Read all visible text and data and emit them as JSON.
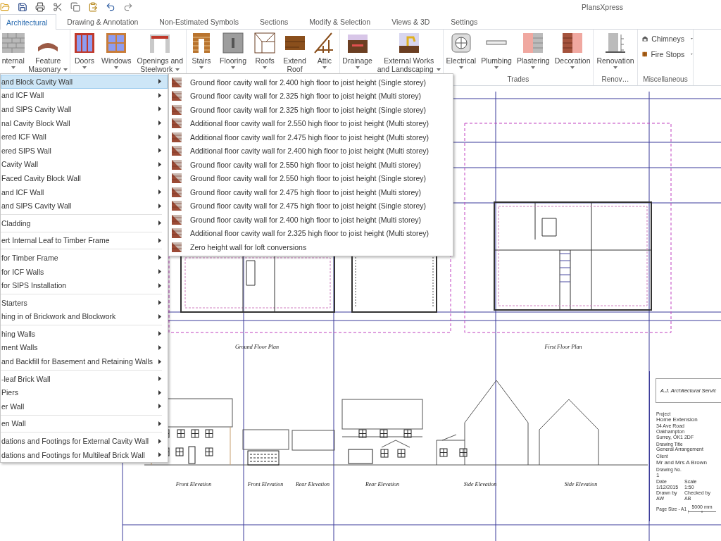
{
  "app": {
    "title": "PlansXpress"
  },
  "tabs": [
    {
      "label": "Architectural",
      "selected": true
    },
    {
      "label": "Drawing & Annotation",
      "selected": false
    },
    {
      "label": "Non-Estimated Symbols",
      "selected": false
    },
    {
      "label": "Sections",
      "selected": false
    },
    {
      "label": "Modify & Selection",
      "selected": false
    },
    {
      "label": "Views & 3D",
      "selected": false
    },
    {
      "label": "Settings",
      "selected": false
    }
  ],
  "ribbon": {
    "groups": [
      {
        "kind": "large",
        "buttons": [
          {
            "label": "nternal",
            "dropdown": true
          },
          {
            "label": "Feature Masonary",
            "dropdown": true
          }
        ]
      },
      {
        "kind": "large",
        "buttons": [
          {
            "label": "Doors",
            "dropdown": true
          },
          {
            "label": "Windows",
            "dropdown": true
          },
          {
            "label": "Openings and Steelwork",
            "dropdown": true
          }
        ]
      },
      {
        "kind": "large",
        "buttons": [
          {
            "label": "Stairs",
            "dropdown": true
          },
          {
            "label": "Flooring",
            "dropdown": true
          },
          {
            "label": "Roofs",
            "dropdown": true
          },
          {
            "label": "Extend Roof",
            "dropdown": false
          },
          {
            "label": "Attic",
            "dropdown": true
          }
        ]
      },
      {
        "kind": "large",
        "buttons": [
          {
            "label": "Drainage",
            "dropdown": true
          },
          {
            "label": "External Works and Landscaping",
            "dropdown": true
          }
        ]
      },
      {
        "kind": "large",
        "label": "Trades",
        "buttons": [
          {
            "label": "Electrical",
            "dropdown": true
          },
          {
            "label": "Plumbing",
            "dropdown": true
          },
          {
            "label": "Plastering",
            "dropdown": true
          },
          {
            "label": "Decoration",
            "dropdown": true
          }
        ]
      },
      {
        "kind": "large",
        "label": "Renov…",
        "buttons": [
          {
            "label": "Renovation",
            "dropdown": true
          }
        ]
      },
      {
        "kind": "small",
        "label": "Miscellaneous",
        "buttons": [
          {
            "label": "Chimneys",
            "dropdown": true
          },
          {
            "label": "Fire Stops",
            "dropdown": true
          }
        ]
      }
    ]
  },
  "menu": {
    "groups": [
      {
        "items": [
          {
            "label": "and Block Cavity Wall",
            "selected": true
          },
          {
            "label": "and ICF Wall",
            "selected": false
          },
          {
            "label": "and SIPS Cavity Wall",
            "selected": false
          },
          {
            "label": "nal Cavity Block Wall",
            "selected": false
          },
          {
            "label": "ered ICF Wall",
            "selected": false
          },
          {
            "label": "ered SIPS Wall",
            "selected": false
          },
          {
            "label": "Cavity Wall",
            "selected": false
          },
          {
            "label": "Faced Cavity Block Wall",
            "selected": false
          },
          {
            "label": "and ICF Wall",
            "selected": false
          },
          {
            "label": "and SIPS Cavity Wall",
            "selected": false
          }
        ]
      },
      {
        "items": [
          {
            "label": "Cladding",
            "selected": false
          }
        ]
      },
      {
        "items": [
          {
            "label": "ert Internal Leaf to Timber Frame",
            "selected": false
          }
        ]
      },
      {
        "items": [
          {
            "label": "for Timber Frame",
            "selected": false
          },
          {
            "label": "for ICF Walls",
            "selected": false
          },
          {
            "label": "for SIPS Installation",
            "selected": false
          }
        ]
      },
      {
        "items": [
          {
            "label": "Starters",
            "selected": false
          },
          {
            "label": "hing in of Brickwork and Blockwork",
            "selected": false
          }
        ]
      },
      {
        "items": [
          {
            "label": "hing Walls",
            "selected": false
          },
          {
            "label": "ment Walls",
            "selected": false
          },
          {
            "label": "and Backfill for Basement and Retaining Walls",
            "selected": false
          }
        ]
      },
      {
        "items": [
          {
            "label": "-leaf Brick Wall",
            "selected": false
          },
          {
            "label": "Piers",
            "selected": false
          },
          {
            "label": "er Wall",
            "selected": false
          }
        ]
      },
      {
        "items": [
          {
            "label": "en Wall",
            "selected": false
          }
        ]
      },
      {
        "items": [
          {
            "label": "dations and Footings for External Cavity Wall",
            "selected": false
          },
          {
            "label": "dations and Footings for Multileaf Brick Wall",
            "selected": false
          }
        ]
      }
    ]
  },
  "submenu": {
    "items": [
      "Ground floor cavity wall for 2.400 high floor to joist height (Single storey)",
      "Ground floor cavity wall for 2.325 high floor to joist height (Multi storey)",
      "Ground floor cavity wall for 2.325 high floor to joist height (Single storey)",
      "Additional floor cavity wall for 2.550 high floor to joist height (Multi storey)",
      "Additional floor cavity wall for 2.475 high floor to joist height (Multi storey)",
      "Additional floor cavity wall for 2.400 high floor to joist height (Multi storey)",
      "Ground floor cavity wall for 2.550 high floor to joist height (Multi storey)",
      "Ground floor cavity wall for 2.550 high floor to joist height (Single storey)",
      "Ground floor cavity wall for 2.475 high floor to joist height (Multi storey)",
      "Ground floor cavity wall for 2.475 high floor to joist height (Single storey)",
      "Ground floor cavity wall for 2.400 high floor to joist height (Multi storey)",
      "Additional floor cavity wall for 2.325 high floor to joist height (Multi storey)",
      "Zero height wall for loft conversions"
    ]
  },
  "drawing": {
    "labels": [
      "Ground Floor Plan",
      "First Floor Plan",
      "Front Elevation",
      "Front Elevation",
      "Rear Elevation",
      "Rear Elevation",
      "Side Elevation",
      "Side Elevation"
    ]
  },
  "title_block": {
    "company": "A.J. Architectural Servic",
    "rows": [
      {
        "kind": "caption",
        "text": "Project"
      },
      {
        "kind": "large",
        "text": "Home Extension"
      },
      {
        "kind": "value",
        "text": "34 Ave Road"
      },
      {
        "kind": "value",
        "text": "Oakhampton"
      },
      {
        "kind": "value",
        "text": "Surrey, OK1 2DF"
      },
      {
        "kind": "caption",
        "text": "Drawing Title"
      },
      {
        "kind": "value",
        "text": "General Arrangement"
      },
      {
        "kind": "caption",
        "text": "Client"
      },
      {
        "kind": "large",
        "text": "Mr and Mrs A Brown"
      },
      {
        "kind": "caption",
        "text": "Drawing No."
      },
      {
        "kind": "large",
        "text": "1"
      },
      {
        "kind": "pair",
        "left": "Date",
        "right": "Scale"
      },
      {
        "kind": "pair",
        "left": "1/12/2015",
        "right": "1:50"
      },
      {
        "kind": "pair",
        "left": "Drawn by",
        "right": "Checked by"
      },
      {
        "kind": "pair",
        "left": "AW",
        "right": "AB"
      }
    ],
    "page_size": "Page Size - A1",
    "scale_bar": "5000 mm"
  }
}
